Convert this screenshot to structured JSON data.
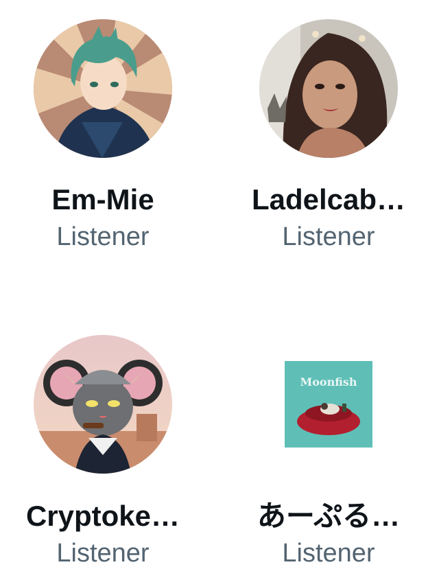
{
  "listeners": [
    {
      "name": "Em-Mie",
      "role": "Listener",
      "avatar_icon": "anime-boy-avatar-icon"
    },
    {
      "name": "Ladelcab…",
      "role": "Listener",
      "avatar_icon": "woman-photo-avatar-icon"
    },
    {
      "name": "Cryptoke…",
      "role": "Listener",
      "avatar_icon": "viking-mouse-avatar-icon"
    },
    {
      "name": "あーぷる…",
      "role": "Listener",
      "avatar_icon": "moonfish-album-avatar-icon",
      "avatar_text": "Moonfish"
    }
  ]
}
